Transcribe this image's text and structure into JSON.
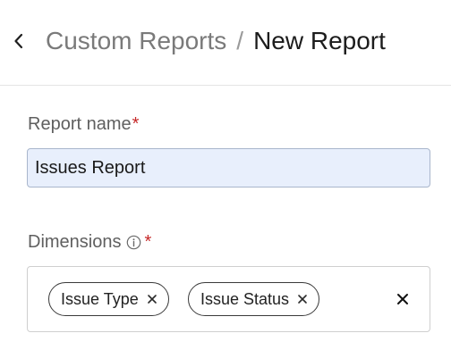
{
  "header": {
    "back_icon": "chevron-left-icon",
    "breadcrumb": {
      "parent": "Custom Reports",
      "separator": "/",
      "current": "New Report"
    }
  },
  "form": {
    "report_name": {
      "label": "Report name",
      "required_mark": "*",
      "value": "Issues Report"
    },
    "dimensions": {
      "label": "Dimensions",
      "info_icon": "info-icon",
      "required_mark": "*",
      "selected": [
        {
          "label": "Issue Type"
        },
        {
          "label": "Issue Status"
        }
      ],
      "clear_icon": "close-icon"
    }
  },
  "colors": {
    "required": "#c62828",
    "input_focus_bg": "#e8effc",
    "breadcrumb_parent": "#7a7a7a"
  }
}
